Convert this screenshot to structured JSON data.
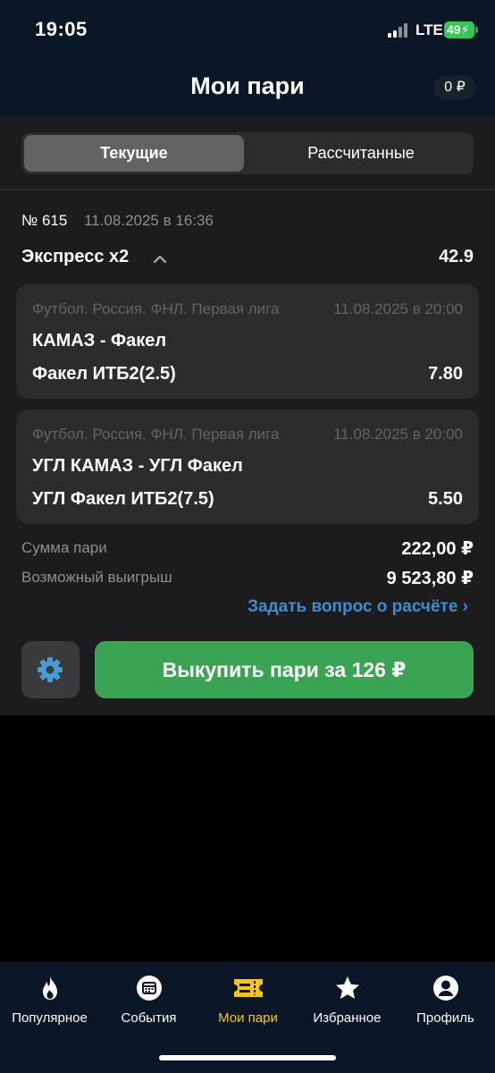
{
  "status_bar": {
    "time": "19:05",
    "network": "LTE",
    "battery": "49"
  },
  "header": {
    "title": "Мои пари",
    "balance": "0 ₽"
  },
  "segments": {
    "current": "Текущие",
    "settled": "Рассчитанные"
  },
  "bet": {
    "number": "№ 615",
    "date": "11.08.2025 в 16:36",
    "type": "Экспресс х2",
    "total_odds": "42.9",
    "events": [
      {
        "league": "Футбол. Россия. ФНЛ. Первая лига",
        "date": "11.08.2025 в 20:00",
        "teams": "КАМАЗ - Факел",
        "pick": "Факел ИТБ2(2.5)",
        "odds": "7.80"
      },
      {
        "league": "Футбол. Россия. ФНЛ. Первая лига",
        "date": "11.08.2025 в 20:00",
        "teams": "УГЛ КАМАЗ - УГЛ Факел",
        "pick": "УГЛ Факел ИТБ2(7.5)",
        "odds": "5.50"
      }
    ],
    "stake_label": "Сумма пари",
    "stake_value": "222,00 ₽",
    "win_label": "Возможный выигрыш",
    "win_value": "9 523,80 ₽",
    "ask_link": "Задать вопрос о расчёте ›",
    "cashout_label": "Выкупить пари за  126 ₽"
  },
  "tabbar": {
    "items": [
      {
        "label": "Популярное",
        "icon": "flame-icon"
      },
      {
        "label": "События",
        "icon": "calendar-icon"
      },
      {
        "label": "Мои пари",
        "icon": "ticket-icon"
      },
      {
        "label": "Избранное",
        "icon": "star-icon"
      },
      {
        "label": "Профиль",
        "icon": "profile-icon"
      }
    ],
    "active_index": 2
  },
  "colors": {
    "accent_yellow": "#f5c518",
    "cashout_green": "#3aa354",
    "link_blue": "#3d8fd0",
    "header_bg": "#0b1626"
  }
}
